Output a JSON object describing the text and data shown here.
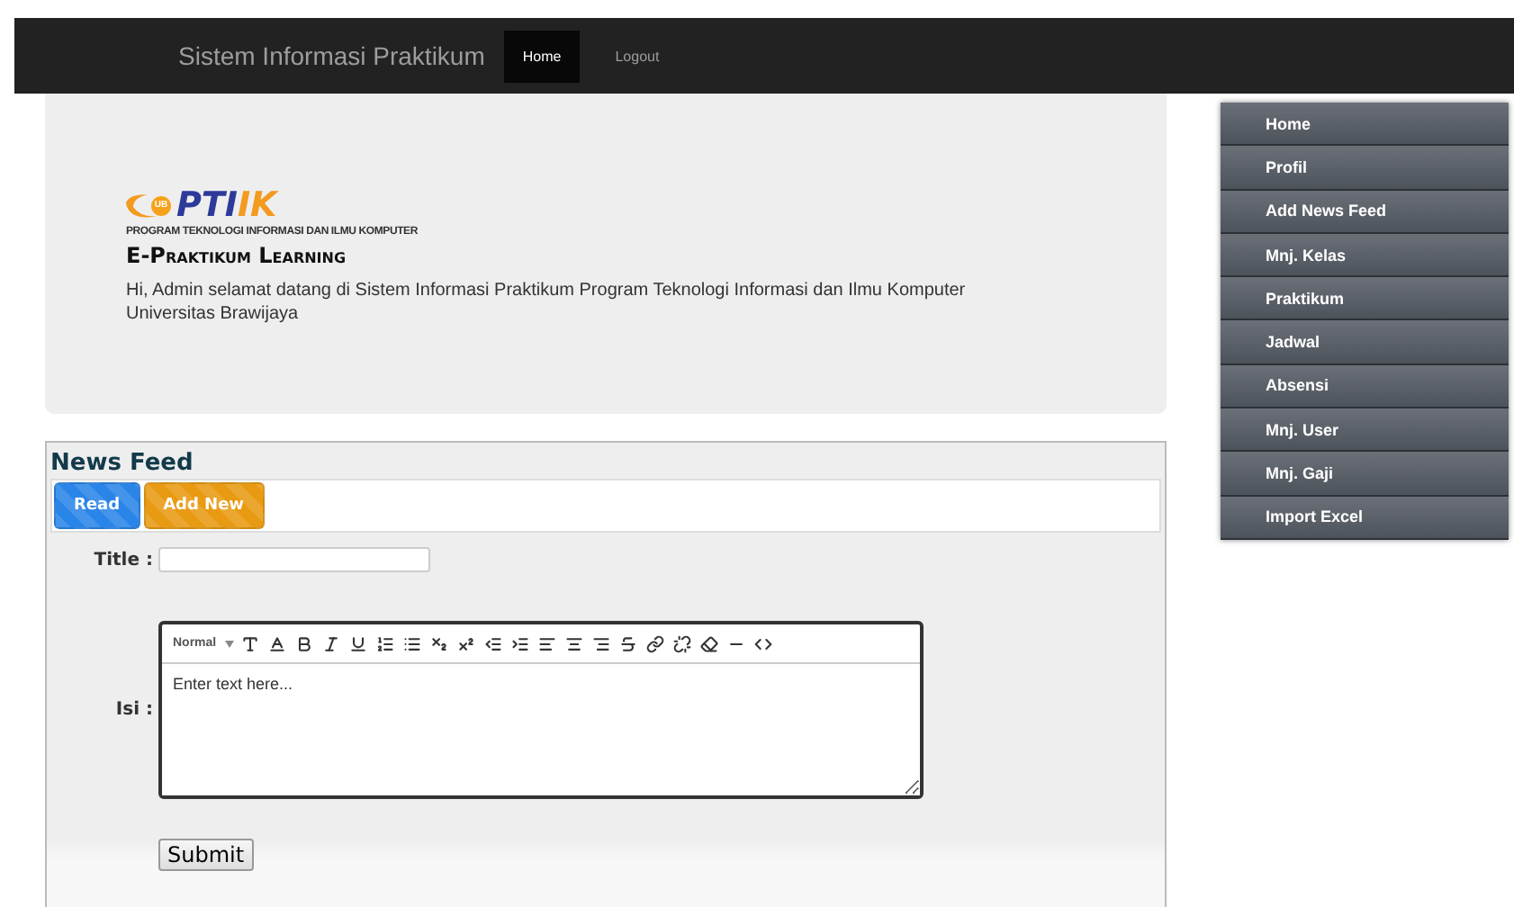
{
  "navbar": {
    "brand": "Sistem Informasi Praktikum",
    "links": [
      {
        "label": "Home",
        "selected": true
      },
      {
        "label": "Logout",
        "selected": false
      }
    ]
  },
  "hero": {
    "logo": {
      "wordmark_blue": "PTI",
      "wordmark_orange": "IK",
      "badge": "UB",
      "caption": "PROGRAM TEKNOLOGI INFORMASI DAN ILMU KOMPUTER"
    },
    "title": "E-Praktikum Learning",
    "greeting": "Hi, Admin selamat datang di Sistem Informasi Praktikum Program Teknologi Informasi dan Ilmu Komputer Universitas Brawijaya"
  },
  "sidebar": {
    "items": [
      "Home",
      "Profil",
      "Add News Feed",
      "Mnj. Kelas",
      "Praktikum",
      "Jadwal",
      "Absensi",
      "Mnj. User",
      "Mnj. Gaji",
      "Import Excel"
    ]
  },
  "news_feed": {
    "title": "News Feed",
    "tabs": [
      {
        "label": "Read",
        "color": "#2a85e8"
      },
      {
        "label": "Add New",
        "color": "#e89a12"
      }
    ],
    "form": {
      "title_label": "Title :",
      "content_label": "Isi :",
      "editor": {
        "format": "Normal",
        "placeholder": "Enter text here..."
      },
      "submit": "Submit"
    }
  }
}
